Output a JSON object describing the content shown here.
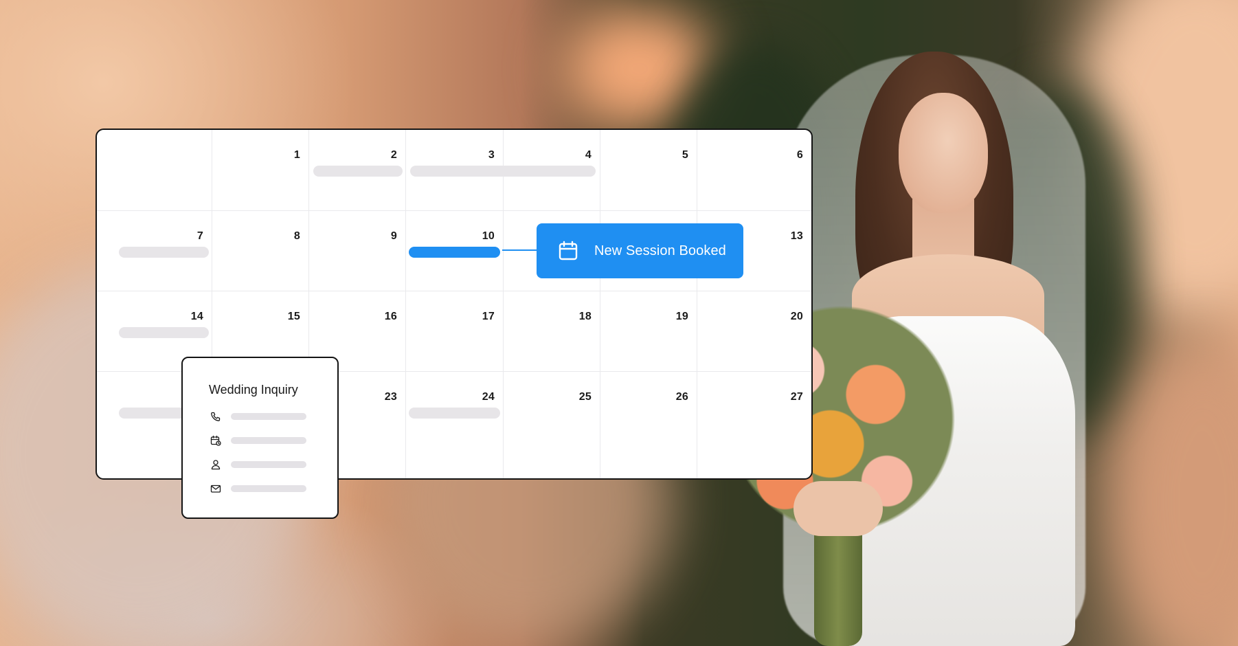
{
  "calendar": {
    "weeks": [
      [
        "",
        "1",
        "2",
        "3",
        "4",
        "5",
        "6"
      ],
      [
        "7",
        "8",
        "9",
        "10",
        "",
        "",
        "13"
      ],
      [
        "14",
        "15",
        "16",
        "17",
        "18",
        "19",
        "20"
      ],
      [
        "",
        "",
        "23",
        "24",
        "25",
        "26",
        "27"
      ]
    ]
  },
  "toast": {
    "label": "New Session Booked",
    "icon": "calendar-icon",
    "color": "#1f8ff2"
  },
  "inquiry": {
    "title": "Wedding Inquiry",
    "rows": [
      {
        "icon": "phone-icon"
      },
      {
        "icon": "calendar-clock-icon"
      },
      {
        "icon": "user-icon"
      },
      {
        "icon": "mail-icon"
      }
    ]
  },
  "colors": {
    "accent": "#1f8ff2",
    "placeholder": "#e7e5e8",
    "border": "#141414"
  }
}
